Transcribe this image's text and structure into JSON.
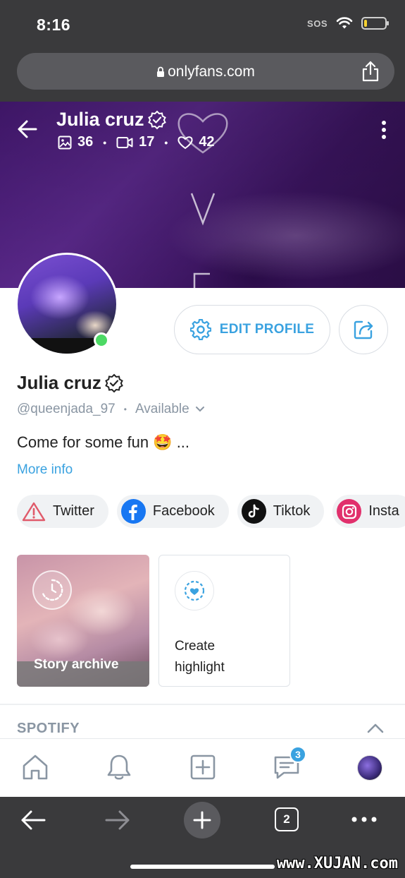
{
  "status_bar": {
    "time": "8:16",
    "sos": "SOS",
    "battery_level": 0.15
  },
  "browser": {
    "url": "onlyfans.com",
    "tab_count": "2"
  },
  "cover": {
    "title": "Julia cruz",
    "stats": {
      "photos": "36",
      "videos": "17",
      "likes": "42"
    }
  },
  "profile": {
    "name": "Julia cruz",
    "handle": "@queenjada_97",
    "status": "Available",
    "bio": "Come for some fun 🤩 ...",
    "more_info": "More info",
    "edit_profile_label": "EDIT PROFILE"
  },
  "socials": [
    {
      "label": "Twitter",
      "icon": "warning-icon"
    },
    {
      "label": "Facebook",
      "icon": "facebook-icon"
    },
    {
      "label": "Tiktok",
      "icon": "tiktok-icon"
    },
    {
      "label": "Insta",
      "icon": "instagram-icon"
    }
  ],
  "stories": {
    "archive_label": "Story archive",
    "highlight_label": "Create\nhighlight"
  },
  "sections": {
    "spotify": "SPOTIFY"
  },
  "app_nav": {
    "messages_badge": "3"
  },
  "watermark": "www.XUJAN.com",
  "colors": {
    "accent": "#3aa2e0",
    "online": "#4cd964",
    "chrome": "#3a3a3c"
  }
}
